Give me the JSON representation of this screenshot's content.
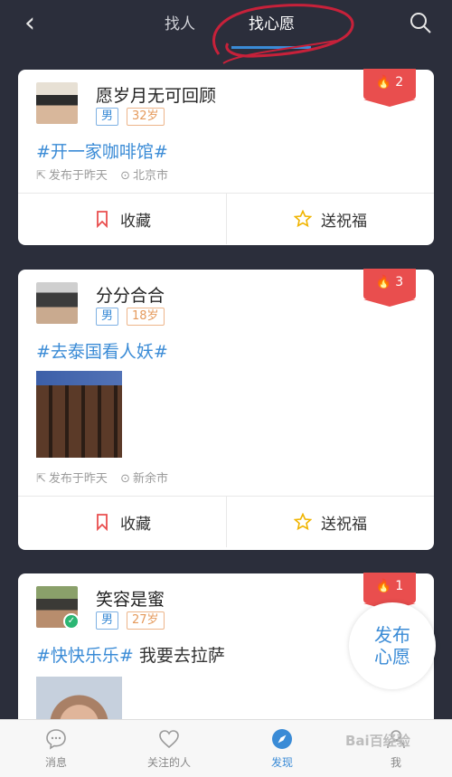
{
  "header": {
    "tabs": [
      {
        "label": "找人",
        "active": false
      },
      {
        "label": "找心愿",
        "active": true
      }
    ]
  },
  "posts": [
    {
      "user_name": "愿岁月无可回顾",
      "gender": "男",
      "age": "32岁",
      "hot": "2",
      "wish": "#开一家咖啡馆#",
      "wish_extra": "",
      "posted": "发布于昨天",
      "location": "北京市",
      "collect": "收藏",
      "bless": "送祝福"
    },
    {
      "user_name": "分分合合",
      "gender": "男",
      "age": "18岁",
      "hot": "3",
      "wish": "#去泰国看人妖#",
      "wish_extra": "",
      "posted": "发布于昨天",
      "location": "新余市",
      "collect": "收藏",
      "bless": "送祝福"
    },
    {
      "user_name": "笑容是蜜",
      "gender": "男",
      "age": "27岁",
      "hot": "1",
      "wish": "#快快乐乐#",
      "wish_extra": "我要去拉萨",
      "posted": "",
      "location": "",
      "collect": "",
      "bless": ""
    }
  ],
  "fab": {
    "line1": "发布",
    "line2": "心愿"
  },
  "bottom_nav": [
    {
      "label": "消息",
      "icon": "chat-icon",
      "active": false
    },
    {
      "label": "关注的人",
      "icon": "heart-icon",
      "active": false
    },
    {
      "label": "发现",
      "icon": "compass-icon",
      "active": true
    },
    {
      "label": "我",
      "icon": "person-icon",
      "active": false
    }
  ],
  "watermark": "Bai百经验",
  "colors": {
    "background": "#2b2e3b",
    "accent": "#3a8bd6",
    "hot": "#e94e4e",
    "age_badge": "#e59a5c",
    "annotation": "#c7213a"
  }
}
